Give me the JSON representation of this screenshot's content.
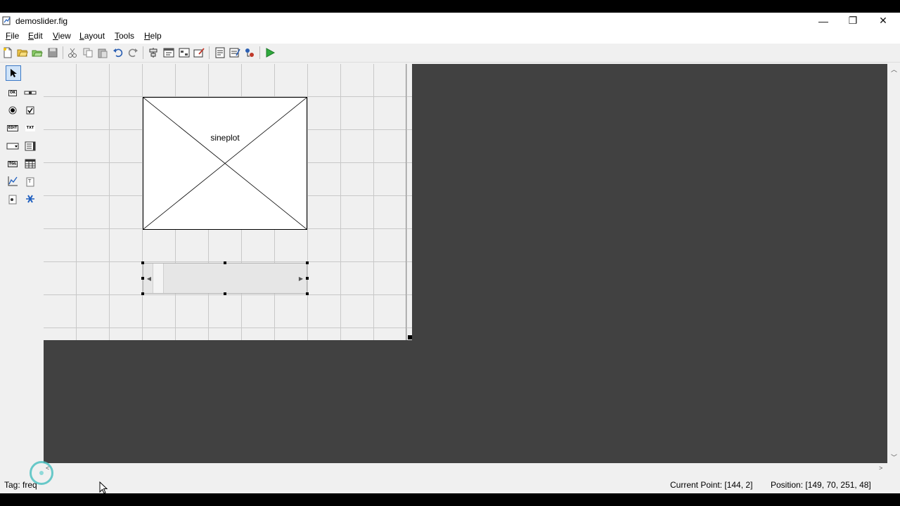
{
  "window": {
    "title": "demoslider.fig",
    "controls": {
      "minimize": "—",
      "restore": "❐",
      "close": "✕"
    }
  },
  "menu": [
    {
      "label": "File",
      "hotkey": "F",
      "rest": "ile"
    },
    {
      "label": "Edit",
      "hotkey": "E",
      "rest": "dit"
    },
    {
      "label": "View",
      "hotkey": "V",
      "rest": "iew"
    },
    {
      "label": "Layout",
      "hotkey": "L",
      "rest": "ayout"
    },
    {
      "label": "Tools",
      "hotkey": "T",
      "rest": "ools"
    },
    {
      "label": "Help",
      "hotkey": "H",
      "rest": "elp"
    }
  ],
  "toolbar": {
    "icons": [
      "new-icon",
      "open-icon",
      "open-recent-icon",
      "save-icon",
      "cut-icon",
      "copy-icon",
      "paste-icon",
      "undo-icon",
      "redo-icon",
      "align-objects-icon",
      "menu-editor-icon",
      "tab-order-editor-icon",
      "toolbar-editor-icon",
      "editor-icon",
      "property-inspector-icon",
      "object-browser-icon",
      "run-figure-icon"
    ]
  },
  "palette": {
    "items": [
      {
        "name": "select-tool",
        "label": ""
      },
      {
        "name": "push-button-tool",
        "label": "OK"
      },
      {
        "name": "slider-tool",
        "label": ""
      },
      {
        "name": "radio-button-tool",
        "label": ""
      },
      {
        "name": "checkbox-tool",
        "label": ""
      },
      {
        "name": "edit-text-tool",
        "label": "EDIT"
      },
      {
        "name": "static-text-tool",
        "label": "TXT"
      },
      {
        "name": "popup-menu-tool",
        "label": ""
      },
      {
        "name": "listbox-tool",
        "label": ""
      },
      {
        "name": "toggle-button-tool",
        "label": "TGL"
      },
      {
        "name": "table-tool",
        "label": ""
      },
      {
        "name": "axes-tool",
        "label": ""
      },
      {
        "name": "panel-tool",
        "label": ""
      },
      {
        "name": "button-group-tool",
        "label": ""
      },
      {
        "name": "activex-control-tool",
        "label": ""
      }
    ]
  },
  "canvas": {
    "axes_tag": "sineplot"
  },
  "status": {
    "tag": "Tag: freq",
    "current_point": "Current Point:  [144, 2]",
    "position": "Position: [149, 70, 251, 48]"
  }
}
